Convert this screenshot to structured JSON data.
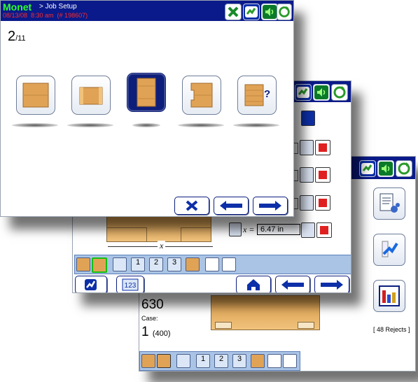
{
  "window1": {
    "brand": "Monet",
    "breadcrumb": "> Job Setup",
    "status_line": "08/13/08  8:30 am  (# 198607)",
    "page_counter": {
      "current": "2",
      "total": "/11"
    },
    "tile_icons": [
      "full-box-icon",
      "half-box-icon",
      "tall-box-icon",
      "notched-box-icon",
      "unknown-box-icon"
    ],
    "selected_tile_index": 2,
    "unknown_mark": "?"
  },
  "window2": {
    "measure_var": "x",
    "measure_equals": "x =",
    "measure_value": "6.47 in",
    "dimension_label": "x"
  },
  "window3": {
    "count_value": "630",
    "case_label": "Case:",
    "case_value": "1",
    "case_sub": "(400)",
    "rejects": "[ 48 Rejects ]"
  },
  "strip_icon_labels": [
    "1",
    "2",
    "3"
  ],
  "colors": {
    "titlebar": "#0a1a8a",
    "accent_blue": "#0d2fa8",
    "cardboard": "#e0a356",
    "strip": "#aac4e6",
    "status_red": "#ff2a2a",
    "brand_green": "#2dff2d"
  }
}
